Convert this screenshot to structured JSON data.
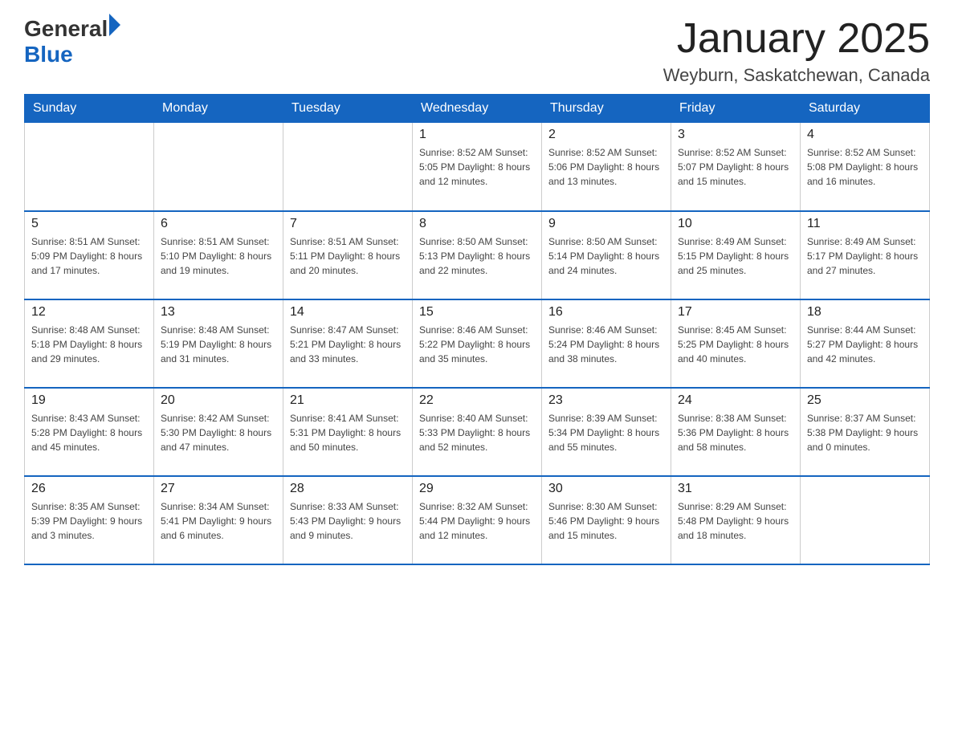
{
  "header": {
    "logo_general": "General",
    "logo_blue": "Blue",
    "title": "January 2025",
    "subtitle": "Weyburn, Saskatchewan, Canada"
  },
  "weekdays": [
    "Sunday",
    "Monday",
    "Tuesday",
    "Wednesday",
    "Thursday",
    "Friday",
    "Saturday"
  ],
  "weeks": [
    [
      {
        "day": "",
        "info": ""
      },
      {
        "day": "",
        "info": ""
      },
      {
        "day": "",
        "info": ""
      },
      {
        "day": "1",
        "info": "Sunrise: 8:52 AM\nSunset: 5:05 PM\nDaylight: 8 hours\nand 12 minutes."
      },
      {
        "day": "2",
        "info": "Sunrise: 8:52 AM\nSunset: 5:06 PM\nDaylight: 8 hours\nand 13 minutes."
      },
      {
        "day": "3",
        "info": "Sunrise: 8:52 AM\nSunset: 5:07 PM\nDaylight: 8 hours\nand 15 minutes."
      },
      {
        "day": "4",
        "info": "Sunrise: 8:52 AM\nSunset: 5:08 PM\nDaylight: 8 hours\nand 16 minutes."
      }
    ],
    [
      {
        "day": "5",
        "info": "Sunrise: 8:51 AM\nSunset: 5:09 PM\nDaylight: 8 hours\nand 17 minutes."
      },
      {
        "day": "6",
        "info": "Sunrise: 8:51 AM\nSunset: 5:10 PM\nDaylight: 8 hours\nand 19 minutes."
      },
      {
        "day": "7",
        "info": "Sunrise: 8:51 AM\nSunset: 5:11 PM\nDaylight: 8 hours\nand 20 minutes."
      },
      {
        "day": "8",
        "info": "Sunrise: 8:50 AM\nSunset: 5:13 PM\nDaylight: 8 hours\nand 22 minutes."
      },
      {
        "day": "9",
        "info": "Sunrise: 8:50 AM\nSunset: 5:14 PM\nDaylight: 8 hours\nand 24 minutes."
      },
      {
        "day": "10",
        "info": "Sunrise: 8:49 AM\nSunset: 5:15 PM\nDaylight: 8 hours\nand 25 minutes."
      },
      {
        "day": "11",
        "info": "Sunrise: 8:49 AM\nSunset: 5:17 PM\nDaylight: 8 hours\nand 27 minutes."
      }
    ],
    [
      {
        "day": "12",
        "info": "Sunrise: 8:48 AM\nSunset: 5:18 PM\nDaylight: 8 hours\nand 29 minutes."
      },
      {
        "day": "13",
        "info": "Sunrise: 8:48 AM\nSunset: 5:19 PM\nDaylight: 8 hours\nand 31 minutes."
      },
      {
        "day": "14",
        "info": "Sunrise: 8:47 AM\nSunset: 5:21 PM\nDaylight: 8 hours\nand 33 minutes."
      },
      {
        "day": "15",
        "info": "Sunrise: 8:46 AM\nSunset: 5:22 PM\nDaylight: 8 hours\nand 35 minutes."
      },
      {
        "day": "16",
        "info": "Sunrise: 8:46 AM\nSunset: 5:24 PM\nDaylight: 8 hours\nand 38 minutes."
      },
      {
        "day": "17",
        "info": "Sunrise: 8:45 AM\nSunset: 5:25 PM\nDaylight: 8 hours\nand 40 minutes."
      },
      {
        "day": "18",
        "info": "Sunrise: 8:44 AM\nSunset: 5:27 PM\nDaylight: 8 hours\nand 42 minutes."
      }
    ],
    [
      {
        "day": "19",
        "info": "Sunrise: 8:43 AM\nSunset: 5:28 PM\nDaylight: 8 hours\nand 45 minutes."
      },
      {
        "day": "20",
        "info": "Sunrise: 8:42 AM\nSunset: 5:30 PM\nDaylight: 8 hours\nand 47 minutes."
      },
      {
        "day": "21",
        "info": "Sunrise: 8:41 AM\nSunset: 5:31 PM\nDaylight: 8 hours\nand 50 minutes."
      },
      {
        "day": "22",
        "info": "Sunrise: 8:40 AM\nSunset: 5:33 PM\nDaylight: 8 hours\nand 52 minutes."
      },
      {
        "day": "23",
        "info": "Sunrise: 8:39 AM\nSunset: 5:34 PM\nDaylight: 8 hours\nand 55 minutes."
      },
      {
        "day": "24",
        "info": "Sunrise: 8:38 AM\nSunset: 5:36 PM\nDaylight: 8 hours\nand 58 minutes."
      },
      {
        "day": "25",
        "info": "Sunrise: 8:37 AM\nSunset: 5:38 PM\nDaylight: 9 hours\nand 0 minutes."
      }
    ],
    [
      {
        "day": "26",
        "info": "Sunrise: 8:35 AM\nSunset: 5:39 PM\nDaylight: 9 hours\nand 3 minutes."
      },
      {
        "day": "27",
        "info": "Sunrise: 8:34 AM\nSunset: 5:41 PM\nDaylight: 9 hours\nand 6 minutes."
      },
      {
        "day": "28",
        "info": "Sunrise: 8:33 AM\nSunset: 5:43 PM\nDaylight: 9 hours\nand 9 minutes."
      },
      {
        "day": "29",
        "info": "Sunrise: 8:32 AM\nSunset: 5:44 PM\nDaylight: 9 hours\nand 12 minutes."
      },
      {
        "day": "30",
        "info": "Sunrise: 8:30 AM\nSunset: 5:46 PM\nDaylight: 9 hours\nand 15 minutes."
      },
      {
        "day": "31",
        "info": "Sunrise: 8:29 AM\nSunset: 5:48 PM\nDaylight: 9 hours\nand 18 minutes."
      },
      {
        "day": "",
        "info": ""
      }
    ]
  ]
}
